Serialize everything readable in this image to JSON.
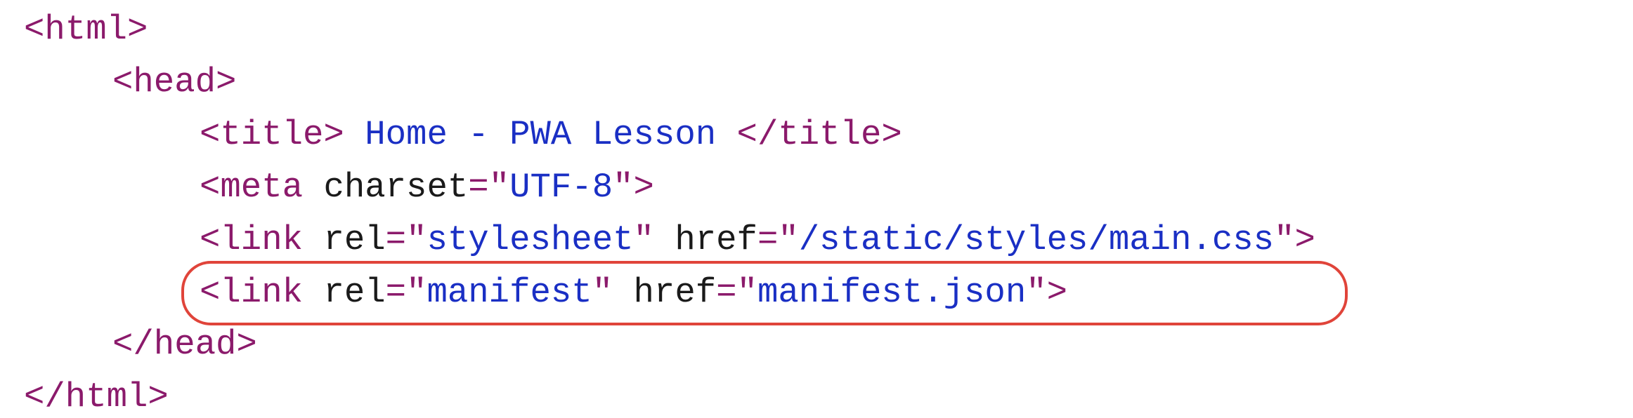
{
  "code": {
    "line1": {
      "open": "<html>"
    },
    "line2": {
      "open": "<head>"
    },
    "line3": {
      "open": "<title>",
      "text": " Home - PWA Lesson ",
      "close": "</title>"
    },
    "line4": {
      "open": "<meta",
      "attr1": "charset",
      "val1": "UTF-8",
      "close": ">"
    },
    "line5": {
      "open": "<link",
      "attr1": "rel",
      "val1": "stylesheet",
      "attr2": "href",
      "val2": "/static/styles/main.css",
      "close": ">"
    },
    "line6": {
      "open": "<link",
      "attr1": "rel",
      "val1": "manifest",
      "attr2": "href",
      "val2": "manifest.json",
      "close": ">"
    },
    "line7": {
      "close": "</head>"
    },
    "line8": {
      "close": "</html>"
    }
  },
  "annotation": {
    "color": "#e0443a"
  },
  "colors": {
    "tag": "#8b1a6b",
    "attribute": "#1a1a1a",
    "value": "#1a2fc4"
  }
}
